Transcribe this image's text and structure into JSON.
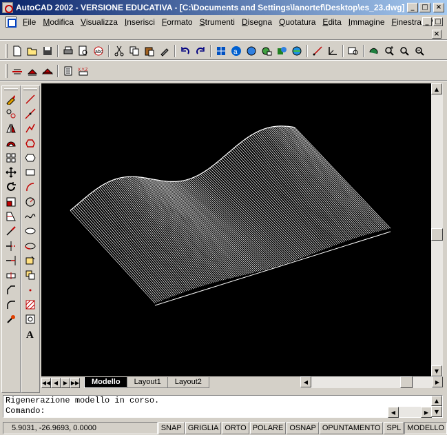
{
  "window": {
    "title": "AutoCAD 2002 - VERSIONE EDUCATIVA - [C:\\Documents and Settings\\lanortef\\Desktop\\es_23.dwg]",
    "btn_minimize": "_",
    "btn_maximize": "□",
    "btn_close": "×"
  },
  "menu": [
    {
      "label": "File"
    },
    {
      "label": "Modifica"
    },
    {
      "label": "Visualizza"
    },
    {
      "label": "Inserisci"
    },
    {
      "label": "Formato"
    },
    {
      "label": "Strumenti"
    },
    {
      "label": "Disegna"
    },
    {
      "label": "Quotatura"
    },
    {
      "label": "Edita"
    },
    {
      "label": "Immagine"
    },
    {
      "label": "Finestra"
    },
    {
      "label": "?"
    }
  ],
  "layout_tabs": [
    {
      "label": "Modello",
      "active": true
    },
    {
      "label": "Layout1"
    },
    {
      "label": "Layout2"
    }
  ],
  "command": {
    "history_line": "Rigenerazione modello in corso.",
    "prompt_line": "Comando:"
  },
  "status": {
    "coordinates": "5.9031, -26.9693, 0.0000",
    "buttons": [
      {
        "label": "SNAP",
        "pressed": false
      },
      {
        "label": "GRIGLIA",
        "pressed": false
      },
      {
        "label": "ORTO",
        "pressed": false
      },
      {
        "label": "POLARE",
        "pressed": false
      },
      {
        "label": "OSNAP",
        "pressed": false
      },
      {
        "label": "OPUNTAMENTO",
        "pressed": false
      },
      {
        "label": "SPL",
        "pressed": false
      },
      {
        "label": "MODELLO",
        "pressed": true
      }
    ]
  },
  "toolbar_standard_icons": [
    "new-icon",
    "open-icon",
    "save-icon",
    "print-icon",
    "print-preview-icon",
    "spell-check-icon",
    "cut-icon",
    "copy-icon",
    "paste-icon",
    "match-properties-icon",
    "undo-icon",
    "redo-icon",
    "grid-icon",
    "browser-icon",
    "network-icon",
    "publish-icon",
    "render-icon",
    "distance-icon",
    "ucs-icon",
    "named-views-icon",
    "pan-icon",
    "zoom-realtime-icon",
    "zoom-window-icon",
    "zoom-previous-icon"
  ],
  "toolbar_layers_icons": [
    "layer-icon",
    "layer-states-icon",
    "layer-manager-icon",
    "properties-icon",
    "xyz-icon"
  ],
  "modify_icons": [
    "erase-icon",
    "copy-object-icon",
    "mirror-icon",
    "offset-icon",
    "array-icon",
    "move-icon",
    "rotate-icon",
    "scale-icon",
    "stretch-icon",
    "lengthen-icon",
    "trim-icon",
    "extend-icon",
    "break-icon",
    "chamfer-icon",
    "fillet-icon",
    "explode-icon"
  ],
  "draw_icons": [
    "line-icon",
    "construction-line-icon",
    "polyline-icon",
    "polygon-icon",
    "rectangle-icon",
    "arc-icon",
    "circle-icon",
    "spline-icon",
    "ellipse-icon",
    "ellipse-arc-icon",
    "insert-block-icon",
    "make-block-icon",
    "point-icon",
    "hatch-icon",
    "region-icon",
    "multiline-text-icon"
  ]
}
